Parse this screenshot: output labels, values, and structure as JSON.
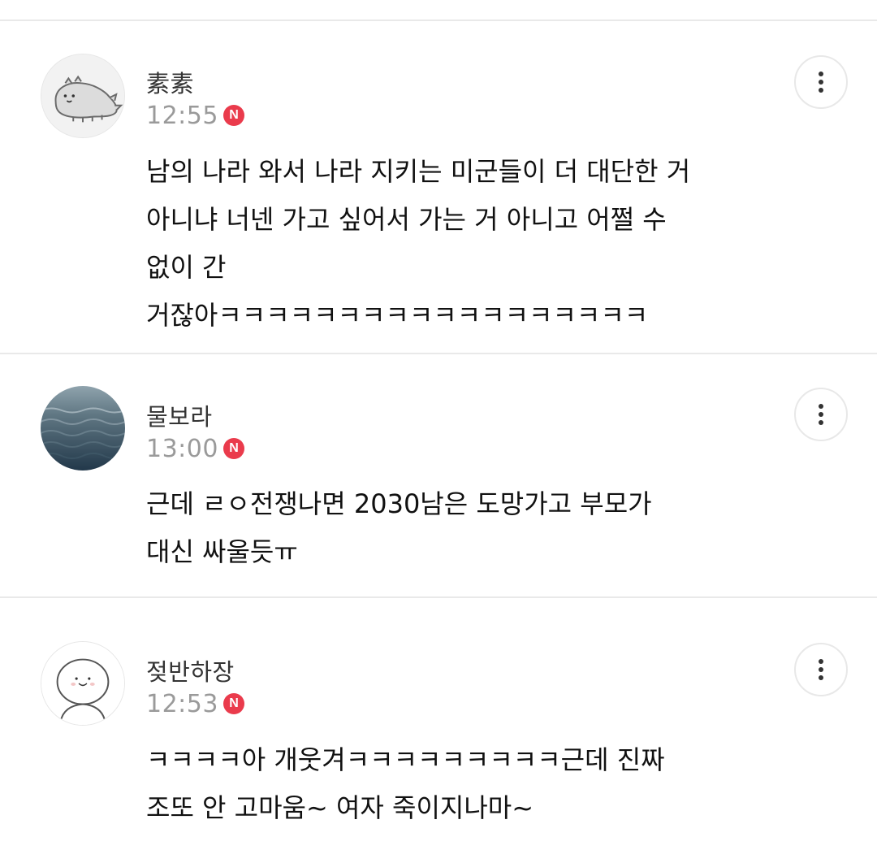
{
  "comments": [
    {
      "author": "素素",
      "time": "12:55",
      "badge": "N",
      "avatar_icon": "dinosaur-character-icon",
      "lines": [
        "남의 나라 와서 나라 지키는 미군들이 더 대단한 거",
        "아니냐 너넨 가고 싶어서 가는 거 아니고 어쩔 수",
        "없이 간",
        "거잖아ㅋㅋㅋㅋㅋㅋㅋㅋㅋㅋㅋㅋㅋㅋㅋㅋㅋㅋ"
      ]
    },
    {
      "author": "물보라",
      "time": "13:00",
      "badge": "N",
      "avatar_icon": "water-photo-icon",
      "lines": [
        "근데 ㄹㅇ전쟁나면 2030남은 도망가고 부모가",
        "대신 싸울듯ㅠ"
      ]
    },
    {
      "author": "젖반하장",
      "time": "12:53",
      "badge": "N",
      "avatar_icon": "cute-character-icon",
      "lines": [
        "ㅋㅋㅋㅋ아 개웃겨ㅋㅋㅋㅋㅋㅋㅋㅋㅋ근데 진짜",
        "조또 안 고마움~ 여자 죽이지나마~"
      ]
    }
  ],
  "colors": {
    "badge": "#ea3b4c",
    "time": "#9a9a9a",
    "divider": "#e9e9e9"
  }
}
